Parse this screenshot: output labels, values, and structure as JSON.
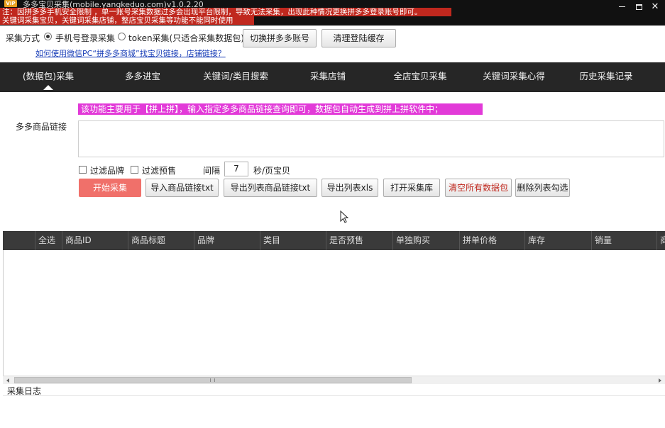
{
  "window": {
    "title": "多多宝贝采集(mobile.yangkeduo.com)v1.0.2.20",
    "icon_text": "VIP",
    "warning_line1": "注：因拼多多手机安全限制 ，单一账号采集数据过多会出现平台限制，导致无法采集，出现此种情况更换拼多多登录账号即可。",
    "warning_line2": "关键词采集宝贝，关键词采集店铺，整店宝贝采集等功能不能同时使用"
  },
  "options": {
    "mode_label": "采集方式",
    "radio_phone_label": "手机号登录采集",
    "radio_token_label": "token采集(只适合采集数据包)",
    "switch_account_button": "切换拼多多账号",
    "clear_cache_button": "清理登陆缓存",
    "help_link": "如何使用微信PC“拼多多商城”找宝贝链接，店铺链接？"
  },
  "nav": {
    "tabs": [
      {
        "label": "(数据包)采集"
      },
      {
        "label": "多多进宝"
      },
      {
        "label": "关键词/类目搜索"
      },
      {
        "label": "采集店铺"
      },
      {
        "label": "全店宝贝采集"
      },
      {
        "label": "关键词采集心得"
      },
      {
        "label": "历史采集记录"
      }
    ],
    "active_index": 0
  },
  "main": {
    "banner": "该功能主要用于【拼上拼】，输入指定多多商品链接查询即可，数据包自动生成到拼上拼软件中；",
    "link_field_label": "多多商品链接",
    "link_field_value": "",
    "filter_brand_label": "过滤品牌",
    "filter_presale_label": "过滤预售",
    "interval_label": "间隔",
    "interval_value": "7",
    "interval_unit": "秒/页宝贝",
    "buttons": {
      "start": "开始采集",
      "import_txt": "导入商品链接txt",
      "export_links_txt": "导出列表商品链接txt",
      "export_xls": "导出列表xls",
      "open_library": "打开采集库",
      "clear_all": "清空所有数据包",
      "delete_checked": "删除列表勾选"
    }
  },
  "table": {
    "columns": [
      "全选",
      "商品ID",
      "商品标题",
      "品牌",
      "类目",
      "是否预售",
      "单独购买",
      "拼单价格",
      "库存",
      "销量",
      "商"
    ]
  },
  "scrollbar": {
    "grip": "III"
  },
  "log": {
    "label": "采集日志"
  },
  "colors": {
    "warning_bg": "#c0281e",
    "banner_bg": "#e23ad8",
    "start_button_bg": "#f0706a",
    "nav_bg": "#262626",
    "table_header_bg": "#3a3a3a"
  }
}
